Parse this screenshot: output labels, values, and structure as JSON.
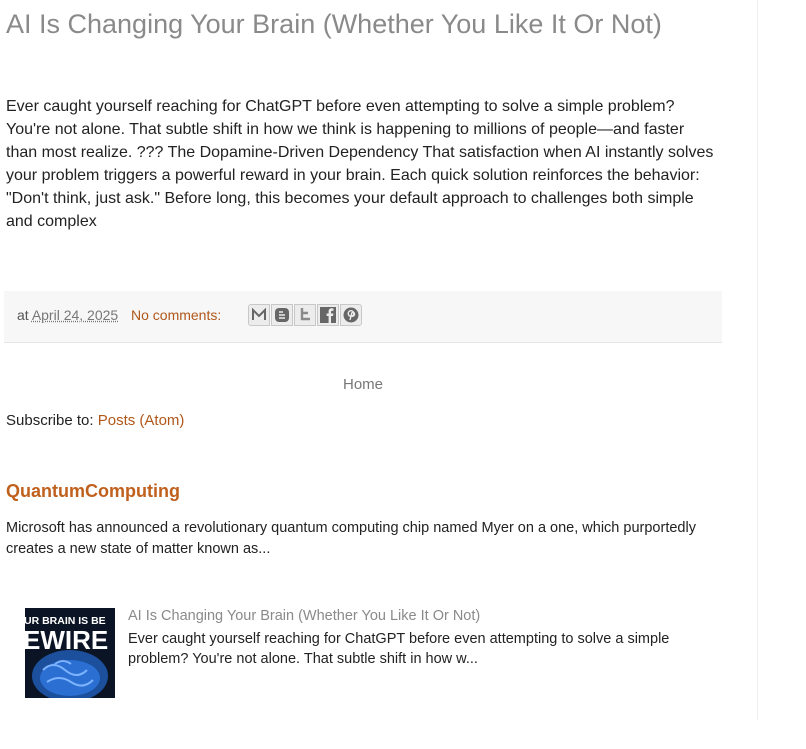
{
  "post": {
    "title": "AI Is Changing Your Brain (Whether You Like It Or Not)",
    "body": "Ever caught yourself reaching for ChatGPT before even attempting to solve a simple problem? You're not alone. That subtle shift in how we think is happening to millions of people—and faster than most realize. ??? The Dopamine-Driven Dependency That satisfaction when AI instantly solves your problem triggers a powerful reward in your brain. Each quick solution reinforces the behavior: \"Don't think, just ask.\" Before long, this becomes your default approach to challenges both simple and complex"
  },
  "footer": {
    "at_label": "at",
    "date": "April 24, 2025",
    "comments": "No comments:",
    "share_buttons": [
      "email-icon",
      "blogger-icon",
      "twitter-icon",
      "facebook-icon",
      "pinterest-icon"
    ]
  },
  "nav": {
    "home": "Home"
  },
  "subscribe": {
    "label": "Subscribe to:",
    "feed": "Posts (Atom)"
  },
  "widget": {
    "title": "QuantumComputing",
    "snippet": "Microsoft has announced a revolutionary quantum computing chip named Myer on a one, which purportedly creates a new state of matter known as..."
  },
  "popular": {
    "title": "AI Is Changing Your Brain (Whether You Like It Or Not)",
    "snippet": "Ever caught yourself reaching for ChatGPT before even attempting to solve a simple problem? You're not alone. That subtle shift in how w...",
    "thumb_text_top": "UR BRAIN IS BE",
    "thumb_text_main": "EWIRE"
  },
  "colors": {
    "link": "#b0571a",
    "title": "#8a8a8a",
    "widget_title": "#c0601d"
  }
}
